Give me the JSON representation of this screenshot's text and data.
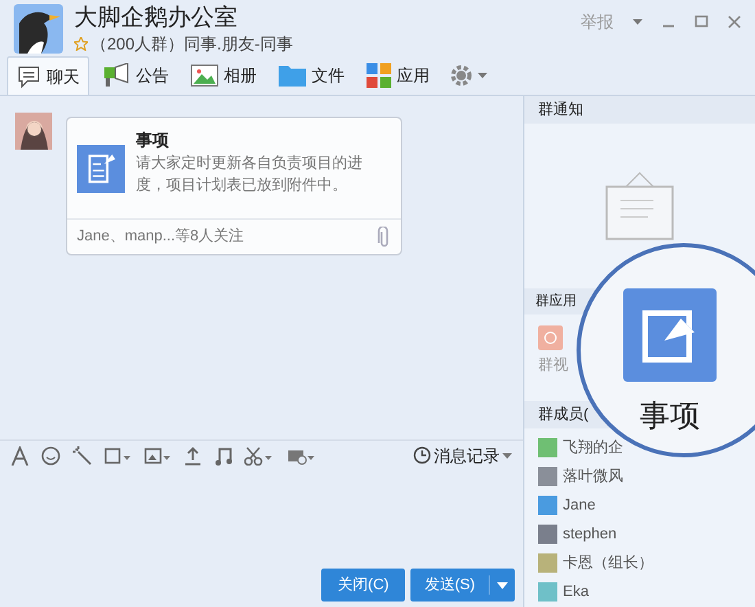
{
  "window": {
    "title": "大脚企鹅办公室",
    "subtitle": "（200人群）同事.朋友-同事",
    "report": "举报"
  },
  "tabs": [
    {
      "label": "聊天",
      "selected": true,
      "kind": "chat"
    },
    {
      "label": "公告",
      "selected": false,
      "kind": "notice"
    },
    {
      "label": "相册",
      "selected": false,
      "kind": "album"
    },
    {
      "label": "文件",
      "selected": false,
      "kind": "file"
    },
    {
      "label": "应用",
      "selected": false,
      "kind": "apps"
    }
  ],
  "message": {
    "title": "事项",
    "body": "请大家定时更新各自负责项目的进度，项目计划表已放到附件中。",
    "followers": "Jane、manp...等8人关注"
  },
  "toolbar": {
    "history": "消息记录"
  },
  "buttons": {
    "close": "关闭(C)",
    "send": "发送(S)"
  },
  "sidebar": {
    "notice_header": "群通知",
    "apps_header": "群应用",
    "app_label": "群视",
    "members_header": "群成员(",
    "members": [
      {
        "name": "飞翔的企",
        "color": "#6fbf73"
      },
      {
        "name": "落叶微风",
        "color": "#8a8f99"
      },
      {
        "name": "Jane",
        "color": "#4a9be0"
      },
      {
        "name": "stephen",
        "color": "#7a7f8c"
      },
      {
        "name": "卡恩（组长）",
        "color": "#b8b27a"
      },
      {
        "name": "Eka",
        "color": "#6fc0c8"
      }
    ]
  },
  "callout": {
    "label": "事项"
  }
}
